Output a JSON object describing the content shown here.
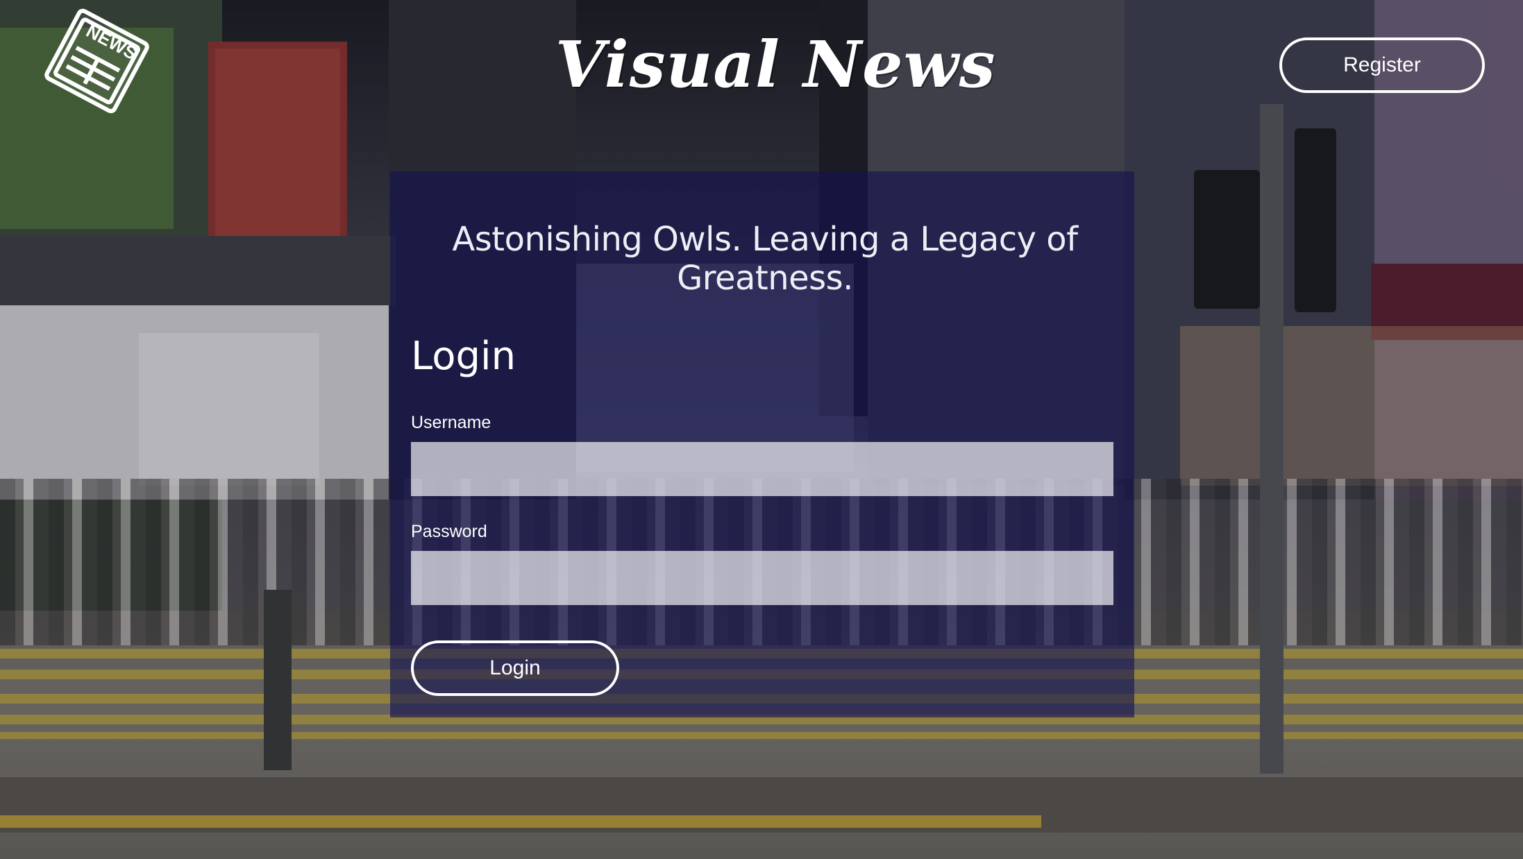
{
  "header": {
    "site_title": "Visual News",
    "logo_icon": "newspaper-icon",
    "logo_text": "NEWS",
    "register_label": "Register"
  },
  "login": {
    "tagline": "Astonishing Owls. Leaving a Legacy of Greatness.",
    "heading": "Login",
    "username_label": "Username",
    "username_value": "",
    "password_label": "Password",
    "password_value": "",
    "submit_label": "Login"
  },
  "colors": {
    "panel_overlay": "#14125099",
    "text": "#ffffff",
    "field_background": "#ffffffa8"
  }
}
